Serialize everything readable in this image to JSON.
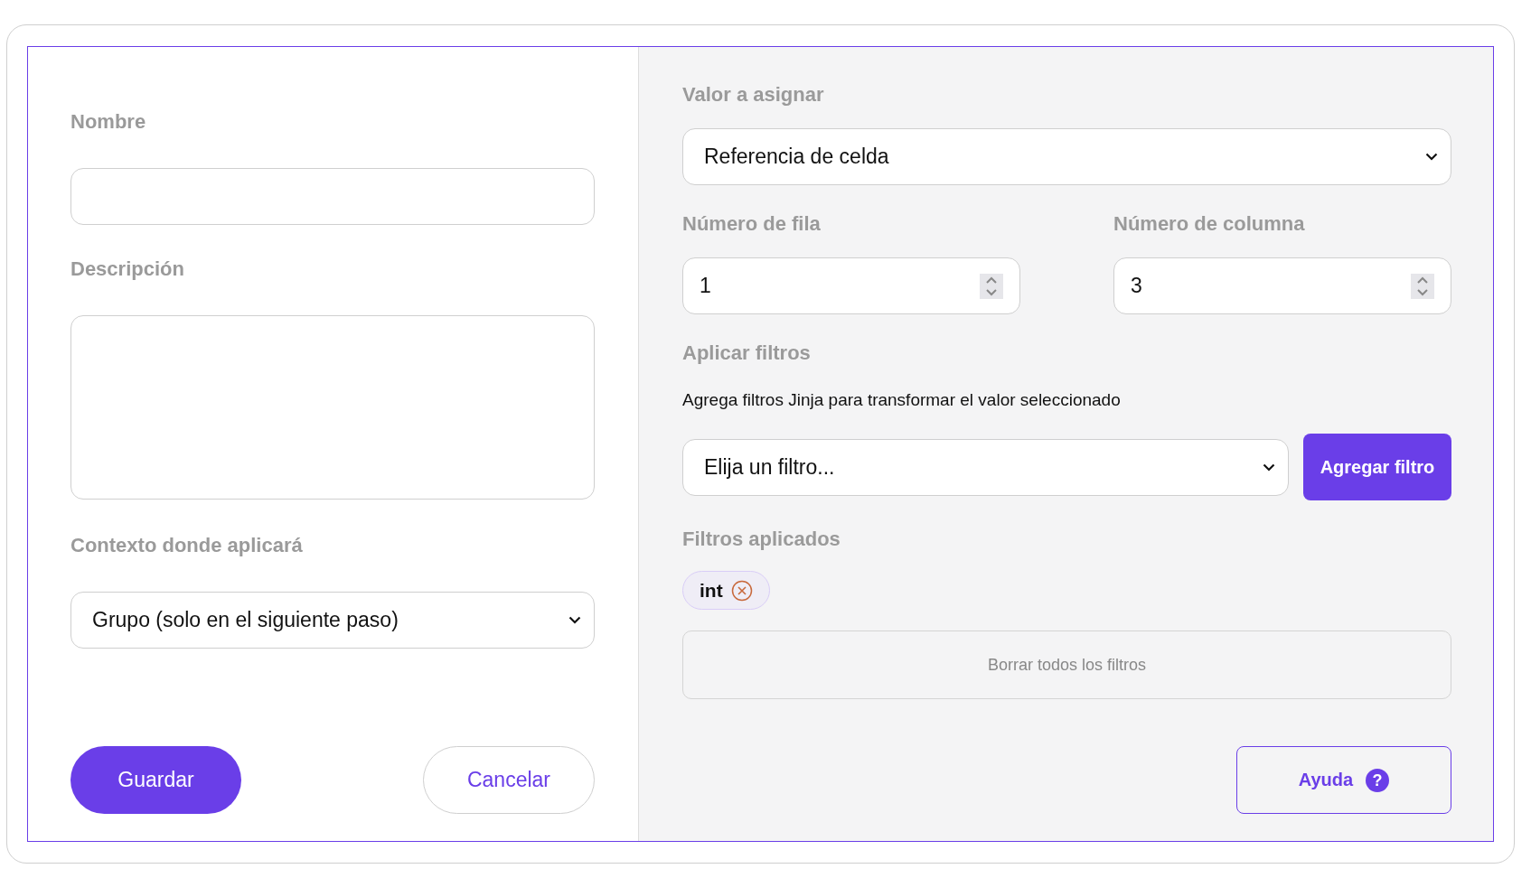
{
  "left": {
    "name": {
      "label": "Nombre"
    },
    "description": {
      "label": "Descripción"
    },
    "context": {
      "label": "Contexto donde aplicará",
      "value": "Grupo (solo en el siguiente paso)"
    },
    "buttons": [
      {
        "label": "Guardar",
        "kind": "primary"
      },
      {
        "label": "Cancelar",
        "kind": "outline"
      }
    ]
  },
  "right": {
    "value_to_assign": {
      "label": "Valor a asignar",
      "value": "Referencia de celda"
    },
    "row_number": {
      "label": "Número de fila",
      "value": "1"
    },
    "column_number": {
      "label": "Número de columna",
      "value": "3"
    },
    "filters": {
      "label": "Aplicar filtros",
      "description": "Agrega filtros Jinja para transformar el valor seleccionado",
      "select": {
        "value": "Elija un filtro..."
      },
      "add_button": "Agregar filtro"
    },
    "applied": {
      "label": "Filtros aplicados",
      "chips": [
        {
          "label": "int"
        }
      ],
      "clear_button": "Borrar todos los filtros"
    },
    "help_button": "Ayuda",
    "help_mark": "?"
  }
}
